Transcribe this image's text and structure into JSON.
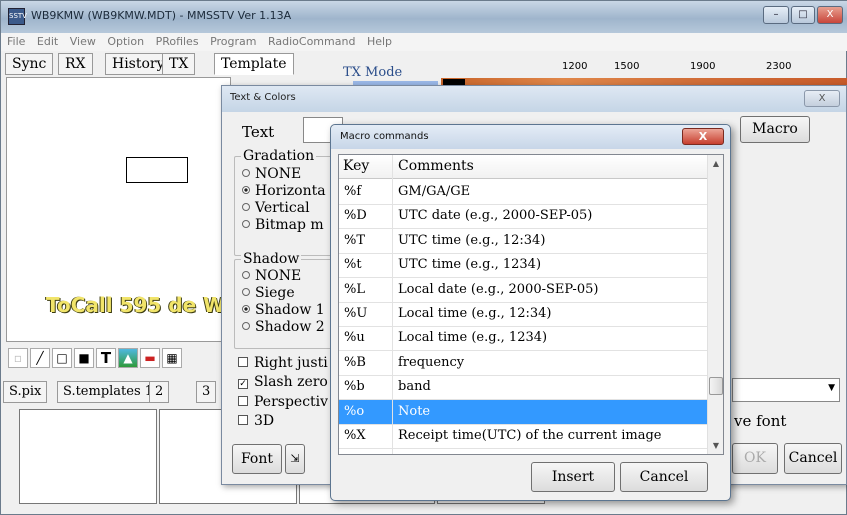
{
  "app": {
    "title": "WB9KMW (WB9KMW.MDT) - MMSSTV Ver 1.13A",
    "icon_label": "SSTV",
    "menu": [
      "File",
      "Edit",
      "View",
      "Option",
      "PRofiles",
      "Program",
      "RadioCommand",
      "Help"
    ],
    "tabs": [
      "Sync",
      "RX",
      "History",
      "TX",
      "Template"
    ],
    "window_buttons": {
      "minimize": "–",
      "maximize": "□",
      "close": "X"
    }
  },
  "waterfall": {
    "scale": [
      "1200",
      "1500",
      "1900",
      "2300"
    ],
    "tx_mode_label": "TX Mode"
  },
  "preview": {
    "tocall_text": "ToCall 595 de W"
  },
  "bottom_tabs": [
    "S.pix",
    "S.templates 1",
    "2",
    "3"
  ],
  "text_colors": {
    "title": "Text & Colors",
    "text_label": "Text",
    "macro_button": "Macro",
    "gradation": {
      "title": "Gradation",
      "options": [
        "NONE",
        "Horizonta",
        "Vertical",
        "Bitmap m"
      ],
      "selected": 1
    },
    "shadow": {
      "title": "Shadow",
      "options": [
        "NONE",
        "Siege",
        "Shadow 1",
        "Shadow 2"
      ],
      "selected": 2
    },
    "checks": [
      {
        "label": "Right justi",
        "checked": false
      },
      {
        "label": "Slash zero",
        "checked": true
      },
      {
        "label": "Perspectiv",
        "checked": false
      },
      {
        "label": "3D",
        "checked": false
      }
    ],
    "font_button": "Font",
    "save_font_label": "ve font",
    "ok_button": "OK",
    "cancel_button": "Cancel",
    "close_glyph": "X"
  },
  "macro_dialog": {
    "title": "Macro commands",
    "close_glyph": "X",
    "columns": [
      "Key",
      "Comments"
    ],
    "rows": [
      {
        "key": "%f",
        "comment": "GM/GA/GE"
      },
      {
        "key": "%D",
        "comment": "UTC date (e.g., 2000-SEP-05)"
      },
      {
        "key": "%T",
        "comment": "UTC time (e.g., 12:34)"
      },
      {
        "key": "%t",
        "comment": "UTC time (e.g., 1234)"
      },
      {
        "key": "%L",
        "comment": "Local date (e.g., 2000-SEP-05)"
      },
      {
        "key": "%U",
        "comment": "Local time (e.g., 12:34)"
      },
      {
        "key": "%u",
        "comment": "Local time (e.g., 1234)"
      },
      {
        "key": "%B",
        "comment": "frequency"
      },
      {
        "key": "%b",
        "comment": "band"
      },
      {
        "key": "%o",
        "comment": "Note"
      },
      {
        "key": "%X",
        "comment": "Receipt time(UTC) of the current image"
      }
    ],
    "selected_index": 9,
    "insert_button": "Insert",
    "cancel_button": "Cancel"
  },
  "colors": {
    "selection": "#3399ff",
    "tocall_text": "#f1e46a"
  }
}
